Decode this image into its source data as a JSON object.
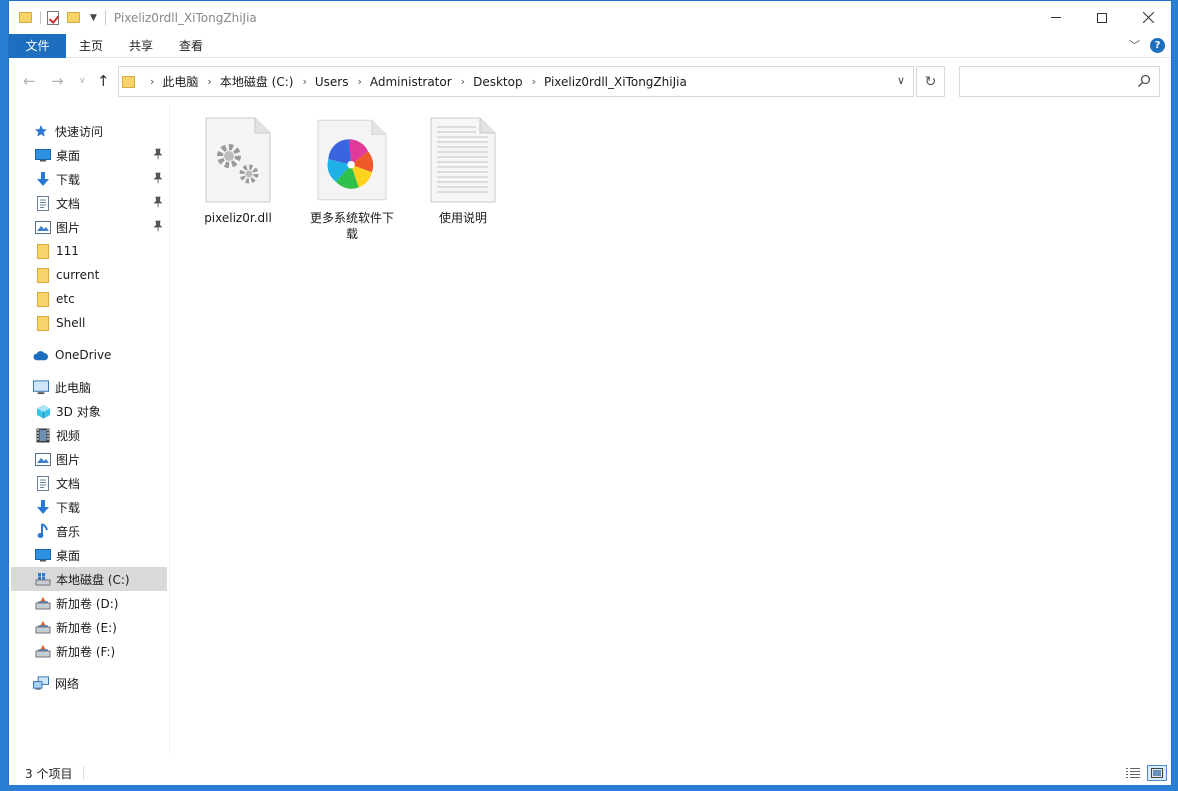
{
  "window": {
    "title": "Pixeliz0rdll_XiTongZhiJia"
  },
  "ribbon": {
    "tabs": [
      "文件",
      "主页",
      "共享",
      "查看"
    ],
    "help_label": "?"
  },
  "address": {
    "crumbs": [
      "此电脑",
      "本地磁盘 (C:)",
      "Users",
      "Administrator",
      "Desktop",
      "Pixeliz0rdll_XiTongZhiJia"
    ],
    "search_placeholder": ""
  },
  "sidebar": {
    "quick_access": "快速访问",
    "quick_items": [
      "桌面",
      "下载",
      "文档",
      "图片",
      "111",
      "current",
      "etc",
      "Shell"
    ],
    "onedrive": "OneDrive",
    "this_pc": "此电脑",
    "pc_items": [
      "3D 对象",
      "视频",
      "图片",
      "文档",
      "下载",
      "音乐",
      "桌面",
      "本地磁盘 (C:)",
      "新加卷 (D:)",
      "新加卷 (E:)",
      "新加卷 (F:)"
    ],
    "network": "网络",
    "selected": "本地磁盘 (C:)"
  },
  "files": [
    {
      "name": "pixeliz0r.dll",
      "icon": "dll-gear-icon"
    },
    {
      "name": "更多系统软件下载",
      "icon": "pinwheel-app-icon"
    },
    {
      "name": "使用说明",
      "icon": "text-document-icon"
    }
  ],
  "status": {
    "count_text": "3 个项目"
  },
  "colors": {
    "accent": "#1e6ebf",
    "folder": "#f7d46b",
    "desktop_bg": "#2a7fd4"
  }
}
